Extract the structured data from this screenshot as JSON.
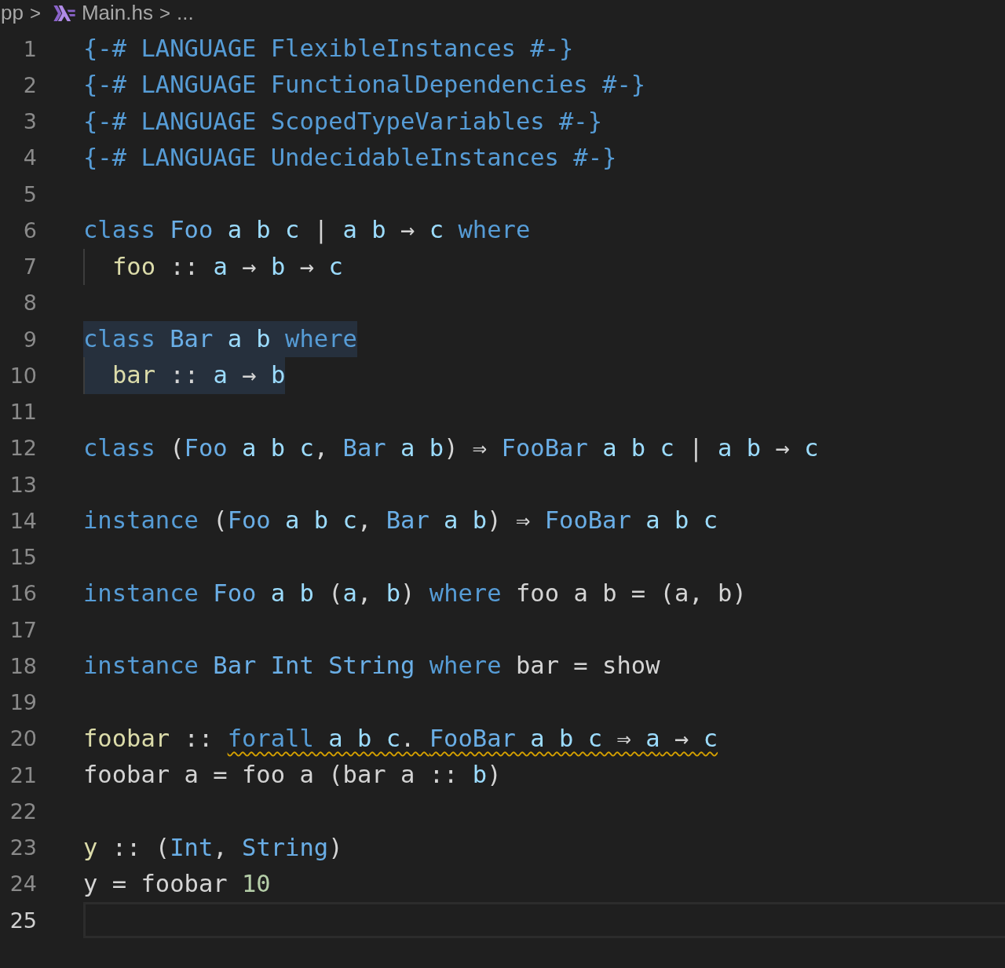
{
  "breadcrumb": {
    "items": [
      {
        "label": "pp",
        "kind": "folder"
      },
      {
        "label": "Main.hs",
        "kind": "file"
      },
      {
        "label": "...",
        "kind": "symbol"
      }
    ],
    "separator": ">"
  },
  "lines": [
    {
      "number": "1",
      "tokens": [
        {
          "t": "{-# LANGUAGE FlexibleInstances #-}",
          "kind": "kw"
        }
      ]
    },
    {
      "number": "2",
      "tokens": [
        {
          "t": "{-# LANGUAGE FunctionalDependencies #-}",
          "kind": "kw"
        }
      ]
    },
    {
      "number": "3",
      "tokens": [
        {
          "t": "{-# LANGUAGE ScopedTypeVariables #-}",
          "kind": "kw"
        }
      ]
    },
    {
      "number": "4",
      "tokens": [
        {
          "t": "{-# LANGUAGE UndecidableInstances #-}",
          "kind": "kw"
        }
      ]
    },
    {
      "number": "5"
    },
    {
      "number": "6",
      "tokens": [
        {
          "t": "class",
          "kind": "kw"
        },
        {
          "t": " Foo",
          "kind": "ty"
        },
        {
          "t": " a b c",
          "kind": "var"
        },
        {
          "t": " | ",
          "kind": "op"
        },
        {
          "t": "a b",
          "kind": "var"
        },
        {
          "t": " → ",
          "kind": "op"
        },
        {
          "t": "c",
          "kind": "var"
        },
        {
          "t": " where",
          "kind": "kw"
        }
      ]
    },
    {
      "number": "7",
      "indent_guide": true,
      "tokens": [
        {
          "t": "foo",
          "kind": "fn"
        },
        {
          "t": " :: ",
          "kind": "op"
        },
        {
          "t": "a",
          "kind": "var"
        },
        {
          "t": " → ",
          "kind": "op"
        },
        {
          "t": "b",
          "kind": "var"
        },
        {
          "t": " → ",
          "kind": "op"
        },
        {
          "t": "c",
          "kind": "var"
        }
      ]
    },
    {
      "number": "8"
    },
    {
      "number": "9",
      "highlighted": true,
      "tokens": [
        {
          "t": "class",
          "kind": "kw"
        },
        {
          "t": " Bar",
          "kind": "ty"
        },
        {
          "t": " a b",
          "kind": "var"
        },
        {
          "t": " where",
          "kind": "kw"
        }
      ]
    },
    {
      "number": "10",
      "highlighted": true,
      "indent_guide": true,
      "tokens": [
        {
          "t": "bar",
          "kind": "fn"
        },
        {
          "t": " :: ",
          "kind": "op"
        },
        {
          "t": "a",
          "kind": "var"
        },
        {
          "t": " → ",
          "kind": "op"
        },
        {
          "t": "b",
          "kind": "var"
        }
      ]
    },
    {
      "number": "11"
    },
    {
      "number": "12",
      "tokens": [
        {
          "t": "class",
          "kind": "kw"
        },
        {
          "t": " (",
          "kind": "op"
        },
        {
          "t": "Foo",
          "kind": "ty"
        },
        {
          "t": " a b c",
          "kind": "var"
        },
        {
          "t": ", ",
          "kind": "op"
        },
        {
          "t": "Bar",
          "kind": "ty"
        },
        {
          "t": " a b",
          "kind": "var"
        },
        {
          "t": ") ⇒ ",
          "kind": "op"
        },
        {
          "t": "FooBar",
          "kind": "ty"
        },
        {
          "t": " a b c",
          "kind": "var"
        },
        {
          "t": " | ",
          "kind": "op"
        },
        {
          "t": "a b",
          "kind": "var"
        },
        {
          "t": " → ",
          "kind": "op"
        },
        {
          "t": "c",
          "kind": "var"
        }
      ]
    },
    {
      "number": "13"
    },
    {
      "number": "14",
      "tokens": [
        {
          "t": "instance",
          "kind": "kw"
        },
        {
          "t": " (",
          "kind": "op"
        },
        {
          "t": "Foo",
          "kind": "ty"
        },
        {
          "t": " a b c",
          "kind": "var"
        },
        {
          "t": ", ",
          "kind": "op"
        },
        {
          "t": "Bar",
          "kind": "ty"
        },
        {
          "t": " a b",
          "kind": "var"
        },
        {
          "t": ") ⇒ ",
          "kind": "op"
        },
        {
          "t": "FooBar",
          "kind": "ty"
        },
        {
          "t": " a b c",
          "kind": "var"
        }
      ]
    },
    {
      "number": "15"
    },
    {
      "number": "16",
      "tokens": [
        {
          "t": "instance",
          "kind": "kw"
        },
        {
          "t": " Foo",
          "kind": "ty"
        },
        {
          "t": " a b",
          "kind": "var"
        },
        {
          "t": " (",
          "kind": "op"
        },
        {
          "t": "a",
          "kind": "var"
        },
        {
          "t": ", ",
          "kind": "op"
        },
        {
          "t": "b",
          "kind": "var"
        },
        {
          "t": ") ",
          "kind": "op"
        },
        {
          "t": "where",
          "kind": "kw"
        },
        {
          "t": " foo a b = (a, b)",
          "kind": "op"
        }
      ]
    },
    {
      "number": "17"
    },
    {
      "number": "18",
      "tokens": [
        {
          "t": "instance",
          "kind": "kw"
        },
        {
          "t": " Bar Int String",
          "kind": "ty"
        },
        {
          "t": " where",
          "kind": "kw"
        },
        {
          "t": " bar = show",
          "kind": "op"
        }
      ]
    },
    {
      "number": "19"
    },
    {
      "number": "20",
      "tokens": [
        {
          "t": "foobar",
          "kind": "fn"
        },
        {
          "t": " :: ",
          "kind": "op"
        },
        {
          "t": "forall",
          "kind": "kw",
          "warning": true
        },
        {
          "t": " a b c",
          "kind": "var",
          "warning": true
        },
        {
          "t": ". ",
          "kind": "op",
          "warning": true
        },
        {
          "t": "FooBar",
          "kind": "ty",
          "warning": true
        },
        {
          "t": " a b c",
          "kind": "var",
          "warning": true
        },
        {
          "t": " ⇒ ",
          "kind": "op",
          "warning": true
        },
        {
          "t": "a",
          "kind": "var",
          "warning": true
        },
        {
          "t": " → ",
          "kind": "op",
          "warning": true
        },
        {
          "t": "c",
          "kind": "var",
          "warning": true
        }
      ]
    },
    {
      "number": "21",
      "tokens": [
        {
          "t": "foobar a = foo a (bar a :: ",
          "kind": "op"
        },
        {
          "t": "b",
          "kind": "var"
        },
        {
          "t": ")",
          "kind": "op"
        }
      ]
    },
    {
      "number": "22"
    },
    {
      "number": "23",
      "tokens": [
        {
          "t": "y",
          "kind": "fn"
        },
        {
          "t": " :: (",
          "kind": "op"
        },
        {
          "t": "Int",
          "kind": "ty"
        },
        {
          "t": ", ",
          "kind": "op"
        },
        {
          "t": "String",
          "kind": "ty"
        },
        {
          "t": ")",
          "kind": "op"
        }
      ]
    },
    {
      "number": "24",
      "tokens": [
        {
          "t": "y = foobar ",
          "kind": "op"
        },
        {
          "t": "10",
          "kind": "num"
        }
      ]
    },
    {
      "number": "25",
      "current": true
    }
  ]
}
